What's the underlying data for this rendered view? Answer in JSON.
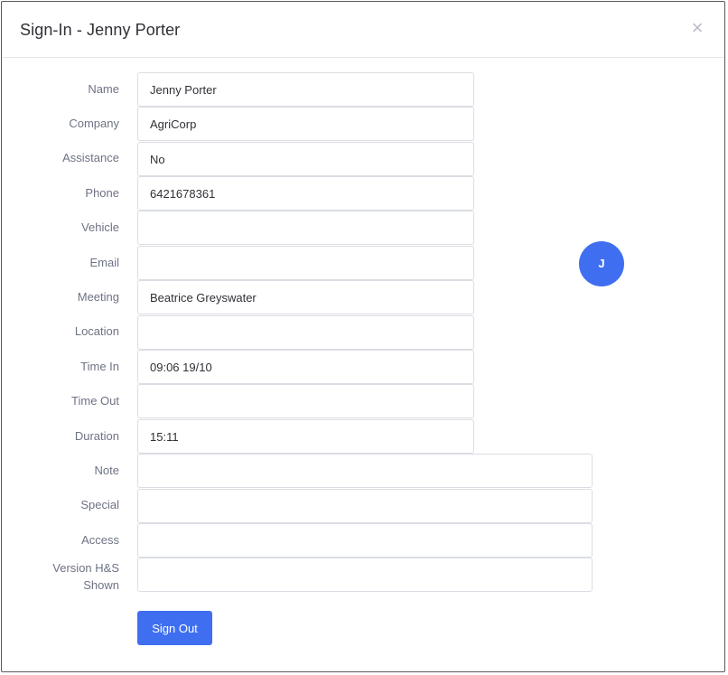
{
  "modal": {
    "title": "Sign-In - Jenny Porter",
    "close_label": "×"
  },
  "avatar": {
    "initial": "J",
    "color": "#3f6ff0"
  },
  "fields": {
    "name": {
      "label": "Name",
      "value": "Jenny Porter"
    },
    "company": {
      "label": "Company",
      "value": "AgriCorp"
    },
    "assistance": {
      "label": "Assistance",
      "value": "No"
    },
    "phone": {
      "label": "Phone",
      "value": "6421678361"
    },
    "vehicle": {
      "label": "Vehicle",
      "value": ""
    },
    "email": {
      "label": "Email",
      "value": ""
    },
    "meeting": {
      "label": "Meeting",
      "value": "Beatrice Greyswater"
    },
    "location": {
      "label": "Location",
      "value": ""
    },
    "time_in": {
      "label": "Time In",
      "value": "09:06 19/10"
    },
    "time_out": {
      "label": "Time Out",
      "value": ""
    },
    "duration": {
      "label": "Duration",
      "value": "15:11"
    },
    "note": {
      "label": "Note",
      "value": ""
    },
    "special": {
      "label": "Special",
      "value": ""
    },
    "access": {
      "label": "Access",
      "value": ""
    },
    "version_hs": {
      "label_line1": "Version H&S",
      "label_line2": "Shown",
      "value": ""
    }
  },
  "actions": {
    "sign_out_label": "Sign Out",
    "accent_color": "#3f6ff0"
  }
}
